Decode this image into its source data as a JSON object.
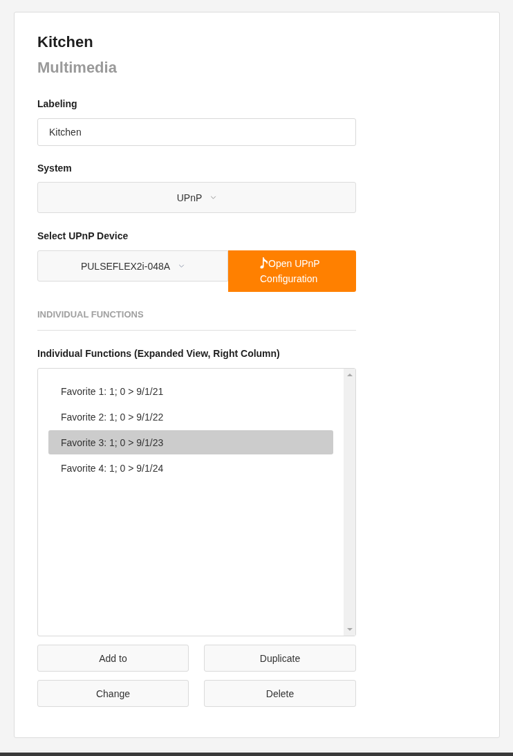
{
  "header": {
    "title": "Kitchen",
    "subtitle": "Multimedia"
  },
  "labeling": {
    "label": "Labeling",
    "value": "Kitchen"
  },
  "system": {
    "label": "System",
    "value": "UPnP"
  },
  "device": {
    "label": "Select UPnP Device",
    "value": "PULSEFLEX2i-048A",
    "button": "Open UPnP Configuration"
  },
  "section": {
    "title": "INDIVIDUAL FUNCTIONS"
  },
  "functions": {
    "label": "Individual Functions (Expanded View, Right Column)",
    "items": [
      {
        "text": "Favorite 1: 1; 0 > 9/1/21",
        "selected": false
      },
      {
        "text": "Favorite 2: 1; 0 > 9/1/22",
        "selected": false
      },
      {
        "text": "Favorite 3: 1; 0 > 9/1/23",
        "selected": true
      },
      {
        "text": "Favorite 4: 1; 0 > 9/1/24",
        "selected": false
      }
    ]
  },
  "buttons": [
    "Add to",
    "Duplicate",
    "Change",
    "Delete"
  ]
}
